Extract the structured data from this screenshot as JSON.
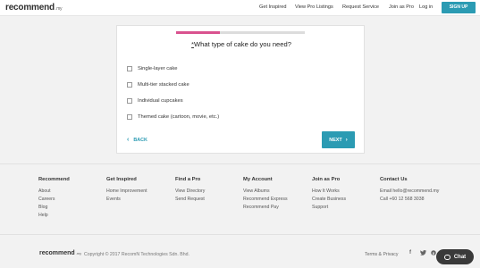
{
  "header": {
    "logo_main": "recommend",
    "logo_suffix": ".my",
    "nav": [
      "Get Inspired",
      "View Pro Listings",
      "Request Service",
      "Join as Pro",
      "Log in"
    ],
    "signup_label": "SIGN UP"
  },
  "wizard": {
    "progress_fraction": 0.34,
    "question_required_marker": "*",
    "question": "What type of cake do you need?",
    "options": [
      "Single-layer cake",
      "Multi-tier stacked cake",
      "Individual cupcakes",
      "Themed cake (cartoon, movie, etc.)"
    ],
    "back_label": "BACK",
    "next_label": "NEXT"
  },
  "footer": {
    "columns": [
      {
        "heading": "Recommend",
        "links": [
          "About",
          "Careers",
          "Blog",
          "Help"
        ]
      },
      {
        "heading": "Get Inspired",
        "links": [
          "Home Improvement",
          "Events"
        ]
      },
      {
        "heading": "Find a Pro",
        "links": [
          "View Directory",
          "Send Request"
        ]
      },
      {
        "heading": "My Account",
        "links": [
          "View Albums",
          "Recommend Express",
          "Recommend Pay"
        ]
      },
      {
        "heading": "Join as Pro",
        "links": [
          "How It Works",
          "Create Business",
          "Support"
        ]
      },
      {
        "heading": "Contact Us",
        "links": [
          "Email hello@recommend.my",
          "Call +60 12 568 3038"
        ]
      }
    ],
    "logo_main": "recommend",
    "logo_suffix": ".my",
    "copyright": "Copyright © 2017 RecomN Technologies Sdn. Bhd.",
    "terms": "Terms & Privacy",
    "social_icons": [
      "facebook-icon",
      "twitter-icon",
      "pinterest-icon"
    ],
    "chat_label": "Chat"
  },
  "colors": {
    "accent": "#2b9bb3",
    "progress": "#d9528f",
    "background": "#f2f2f2"
  }
}
